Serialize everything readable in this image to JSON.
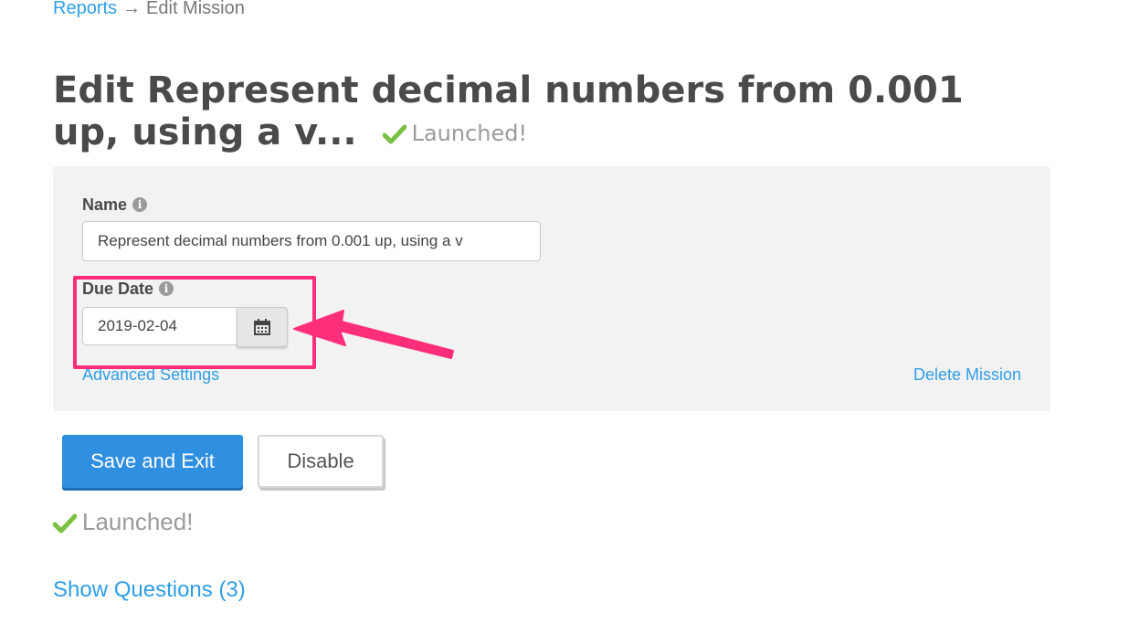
{
  "breadcrumb": {
    "parent": "Reports",
    "separator": "→",
    "current": "Edit Mission"
  },
  "page": {
    "title": "Edit Represent decimal numbers from 0.001 up, using a v...",
    "status": "Launched!"
  },
  "form": {
    "name_label": "Name",
    "name_value": "Represent decimal numbers from 0.001 up, using a v",
    "due_date_label": "Due Date",
    "due_date_value": "2019-02-04",
    "advanced_settings": "Advanced Settings",
    "delete_mission": "Delete Mission"
  },
  "actions": {
    "save": "Save and Exit",
    "disable": "Disable"
  },
  "footer": {
    "status": "Launched!",
    "show_questions": "Show Questions (3)"
  },
  "icons": {
    "check": "check-icon",
    "info": "info-icon",
    "calendar": "calendar-icon"
  },
  "colors": {
    "accent": "#2f9ee6",
    "primary_button": "#2f8fe0",
    "check": "#7ac142",
    "annotation": "#ff2e7a"
  }
}
